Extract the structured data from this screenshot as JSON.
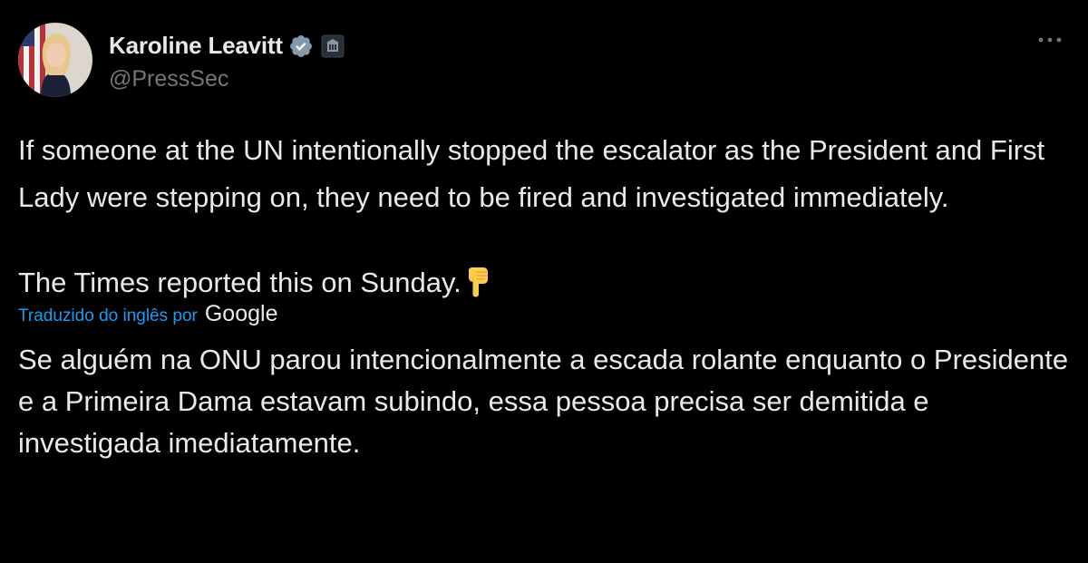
{
  "author": {
    "display_name": "Karoline Leavitt",
    "handle": "@PressSec",
    "verified_icon": "verified-badge-icon",
    "affiliation_icon": "government-badge-icon"
  },
  "menu": {
    "more_icon": "more-options-icon"
  },
  "tweet": {
    "paragraph_1": "If someone at the UN intentionally stopped the escalator as the President and First Lady were stepping on, they need to be fired and investigated immediately.",
    "paragraph_2": "The Times reported this on Sunday.",
    "emoji": "backhand-index-pointing-down"
  },
  "translation": {
    "label": "Traduzido do inglês por",
    "provider": "Google",
    "text": "Se alguém na ONU parou intencionalmente a escada rolante enquanto o Presidente e a Primeira Dama estavam subindo, essa pessoa precisa ser demitida e investigada imediatamente."
  },
  "colors": {
    "background": "#000000",
    "text": "#e7e9ea",
    "secondary_text": "#71767b",
    "link": "#1d9bf0",
    "verified_badge": "#829aab"
  }
}
